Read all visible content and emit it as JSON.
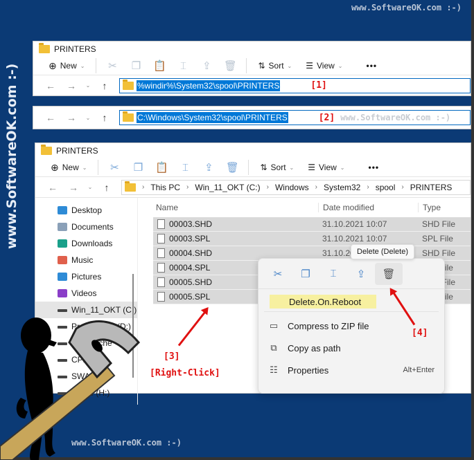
{
  "watermark": {
    "top": "www.SoftwareOK.com :-)",
    "bottom": "www.SoftwareOK.com :-)",
    "side": "www.SoftwareOK.com :-)",
    "inline": "www.SoftwareOK.com :-)"
  },
  "window1": {
    "title": "PRINTERS",
    "toolbar": {
      "new_label": "New",
      "sort_label": "Sort",
      "view_label": "View",
      "more_label": "•••"
    },
    "address": "%windir%\\System32\\spool\\PRINTERS",
    "tag": "[1]"
  },
  "window2": {
    "address": "C:\\Windows\\System32\\spool\\PRINTERS",
    "tag": "[2]"
  },
  "window3": {
    "title": "PRINTERS",
    "toolbar": {
      "new_label": "New",
      "sort_label": "Sort",
      "view_label": "View",
      "more_label": "•••"
    },
    "breadcrumb": [
      "This PC",
      "Win_11_OKT (C:)",
      "Windows",
      "System32",
      "spool",
      "PRINTERS"
    ],
    "sidebar": [
      {
        "label": "Desktop",
        "icon": "desktop-icon",
        "color": "#2e8bd6"
      },
      {
        "label": "Documents",
        "icon": "documents-icon",
        "color": "#8aa0b8"
      },
      {
        "label": "Downloads",
        "icon": "downloads-icon",
        "color": "#1aa08a"
      },
      {
        "label": "Music",
        "icon": "music-icon",
        "color": "#e0604c"
      },
      {
        "label": "Pictures",
        "icon": "pictures-icon",
        "color": "#2e8bd6"
      },
      {
        "label": "Videos",
        "icon": "videos-icon",
        "color": "#8a3ec8"
      },
      {
        "label": "Win_11_OKT (C:)",
        "icon": "drive-icon",
        "active": true
      },
      {
        "label": "Programme (D:)",
        "icon": "drive-icon"
      },
      {
        "label": "Inet-Cache",
        "icon": "drive-icon"
      },
      {
        "label": "CPP2018",
        "icon": "drive-icon"
      },
      {
        "label": "SWAP",
        "icon": "drive-icon"
      },
      {
        "label": "Home (H:)",
        "icon": "drive-icon"
      }
    ],
    "columns": {
      "name": "Name",
      "date": "Date modified",
      "type": "Type"
    },
    "files": [
      {
        "name": "00003.SHD",
        "date": "31.10.2021 10:07",
        "type": "SHD File"
      },
      {
        "name": "00003.SPL",
        "date": "31.10.2021 10:07",
        "type": "SPL File"
      },
      {
        "name": "00004.SHD",
        "date": "31.10.2021 10:07",
        "type": "SHD File"
      },
      {
        "name": "00004.SPL",
        "date": "",
        "type": "SPL File"
      },
      {
        "name": "00005.SHD",
        "date": "",
        "type": "SHD File"
      },
      {
        "name": "00005.SPL",
        "date": "",
        "type": "SPL File"
      }
    ]
  },
  "context_menu": {
    "tooltip": "Delete (Delete)",
    "highlight_item": "Delete.On.Reboot",
    "items": [
      {
        "label": "Compress to ZIP file",
        "icon": "zip-icon",
        "shortcut": ""
      },
      {
        "label": "Copy as path",
        "icon": "copy-path-icon",
        "shortcut": ""
      },
      {
        "label": "Properties",
        "icon": "properties-icon",
        "shortcut": "Alt+Enter"
      }
    ]
  },
  "annotations": {
    "tag3": "[3]",
    "right_click": "[Right-Click]",
    "tag4": "[4]"
  }
}
